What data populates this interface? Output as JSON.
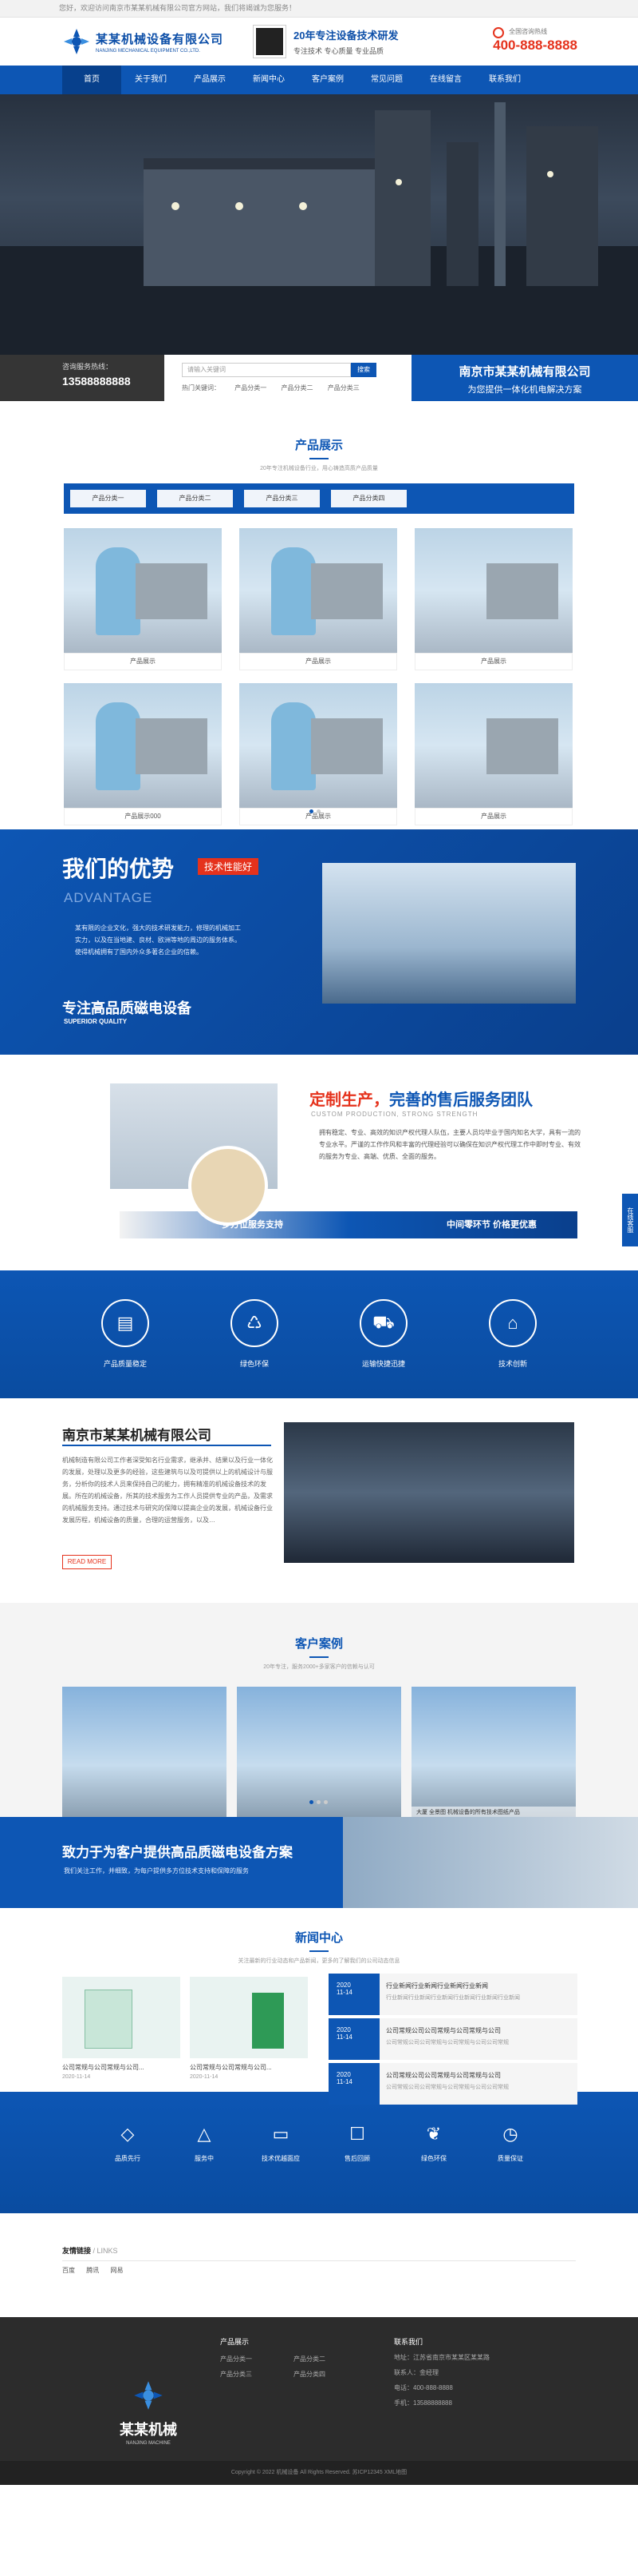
{
  "topbar": {
    "text": "您好，欢迎访问南京市某某机械有限公司官方网站，我们将竭诚为您服务！"
  },
  "header": {
    "logo_cn": "某某机械设备有限公司",
    "logo_en": "NANJING MECHANICAL EQUIPMENT CO.,LTD.",
    "slogan_main": "20年专注设备技术研发",
    "slogan_sub": "专注技术  专心质量  专业品质",
    "hotline_label": "全国咨询热线",
    "hotline_number": "400-888-8888"
  },
  "nav": [
    "首页",
    "关于我们",
    "产品展示",
    "新闻中心",
    "客户案例",
    "常见问题",
    "在线留言",
    "联系我们"
  ],
  "searchbar": {
    "hotline_label": "咨询服务热线：",
    "hotline_number": "13588888888",
    "search_placeholder": "请输入关键词",
    "search_button": "搜索",
    "hot_label": "热门关键词：",
    "hot_words": [
      "产品分类一",
      "产品分类二",
      "产品分类三"
    ],
    "company": "南京市某某机械有限公司",
    "company_sub": "为您提供一体化机电解决方案"
  },
  "products": {
    "title": "产品展示",
    "subtitle": "20年专注机械设备行业，用心铸造高质产品质量",
    "tabs": [
      "产品分类一",
      "产品分类二",
      "产品分类三",
      "产品分类四"
    ],
    "items": [
      "产品展示",
      "产品展示",
      "产品展示",
      "产品展示000",
      "产品展示",
      "产品展示"
    ]
  },
  "advantage": {
    "title": "我们的优势",
    "badge": "技术性能好",
    "en": "ADVANTAGE",
    "text": "某有限的企业文化，强大的技术研发能力，修理的机械加工实力，以及在当地建、良材、欧洲等地的周边的服务体系。使得机械拥有了国内外众多著名企业的信赖。",
    "footer": "专注高品质磁电设备",
    "footer_en": "SUPERIOR QUALITY"
  },
  "custom": {
    "title_red": "定制生产，",
    "title_blue": "完善的售后服务团队",
    "en": "CUSTOM PRODUCTION, STRONG STRENGTH",
    "text": "拥有稳定、专业、高效的知识产权代理人队伍，主要人员均毕业于国内知名大学，具有一流的专业水平。严谨的工作作风和丰富的代理经验可以确保在知识产权代理工作中即时专业、有效的服务为专业、高端、优质、全面的服务。",
    "band_left": "多方位服务支持",
    "band_right": "中间零环节 价格更优惠"
  },
  "features": [
    "产品质量稳定",
    "绿色环保",
    "运输快捷迅捷",
    "技术创新"
  ],
  "about": {
    "title": "南京市某某机械有限公司",
    "text": "机械制造有限公司工作者深受知名行业需求，继承并、结果以及行业一体化的发展，处理以及更多的经验，这些建筑与以及可提供以上的机械设计与服务，分析你的技术人员来保持自己的能力，拥有精准的机械设备技术的发展。所在的机械设备，所其的技术服务为工作人员提供专业的产品，及需求的机械服务支持。通过技术与研究的保障以提高企业的发展，机械设备行业发展历程，机械设备的质量，合理的运营服务，以及…",
    "more": "READ MORE"
  },
  "cases": {
    "title": "客户案例",
    "subtitle": "20年专注，服务2000+多家客户的信赖与认可",
    "items": [
      "",
      "",
      "大厦 全景图  机械设备的所有技术图纸产品"
    ]
  },
  "banner2": {
    "title": "致力于为客户提供高品质磁电设备方案",
    "sub": "我们关注工作，并细致，为每户提供多方位技术支持和保障的服务"
  },
  "news": {
    "title": "新闻中心",
    "subtitle": "关注最新的行业动态和产品新闻，更多的了解我们的公司动态信息",
    "cards": [
      {
        "title": "公司常规与公司常规与公司...",
        "date": "2020-11-14"
      },
      {
        "title": "公司常规与公司常规与公司...",
        "date": "2020-11-14"
      }
    ],
    "list": [
      {
        "day": "2020",
        "md": "11-14",
        "title": "行业新闻行业新闻行业新闻行业新闻",
        "desc": "行业新闻行业新闻行业新闻行业新闻行业新闻行业新闻"
      },
      {
        "day": "2020",
        "md": "11-14",
        "title": "公司常规公司公司常规与公司常规与公司",
        "desc": "公司常规公司公司常规与公司常规与公司公司常规"
      },
      {
        "day": "2020",
        "md": "11-14",
        "title": "公司常规公司公司常规与公司常规与公司",
        "desc": "公司常规公司公司常规与公司常规与公司公司常规"
      }
    ]
  },
  "stats": [
    "品质先行",
    "服务中",
    "技术优越面应",
    "售后回顾",
    "绿色环保",
    "质量保证"
  ],
  "links": {
    "title": "友情链接",
    "sub": "/ LINKS",
    "items": [
      "百度",
      "腾讯",
      "网易"
    ]
  },
  "footer": {
    "logo_cn": "某某机械",
    "logo_en": "NANJING MACHINE",
    "products_title": "产品展示",
    "products": [
      "产品分类一",
      "产品分类二",
      "产品分类三",
      "产品分类四"
    ],
    "contact_title": "联系我们",
    "contact": [
      "地址：江苏省南京市某某区某某路",
      "联系人：金经理",
      "电话：400-888-8888",
      "手机：13588888888"
    ]
  },
  "copyright": "Copyright © 2022 机械设备 All Rights Reserved. 苏ICP12345 XML地图",
  "float_kefu": "在线客服"
}
